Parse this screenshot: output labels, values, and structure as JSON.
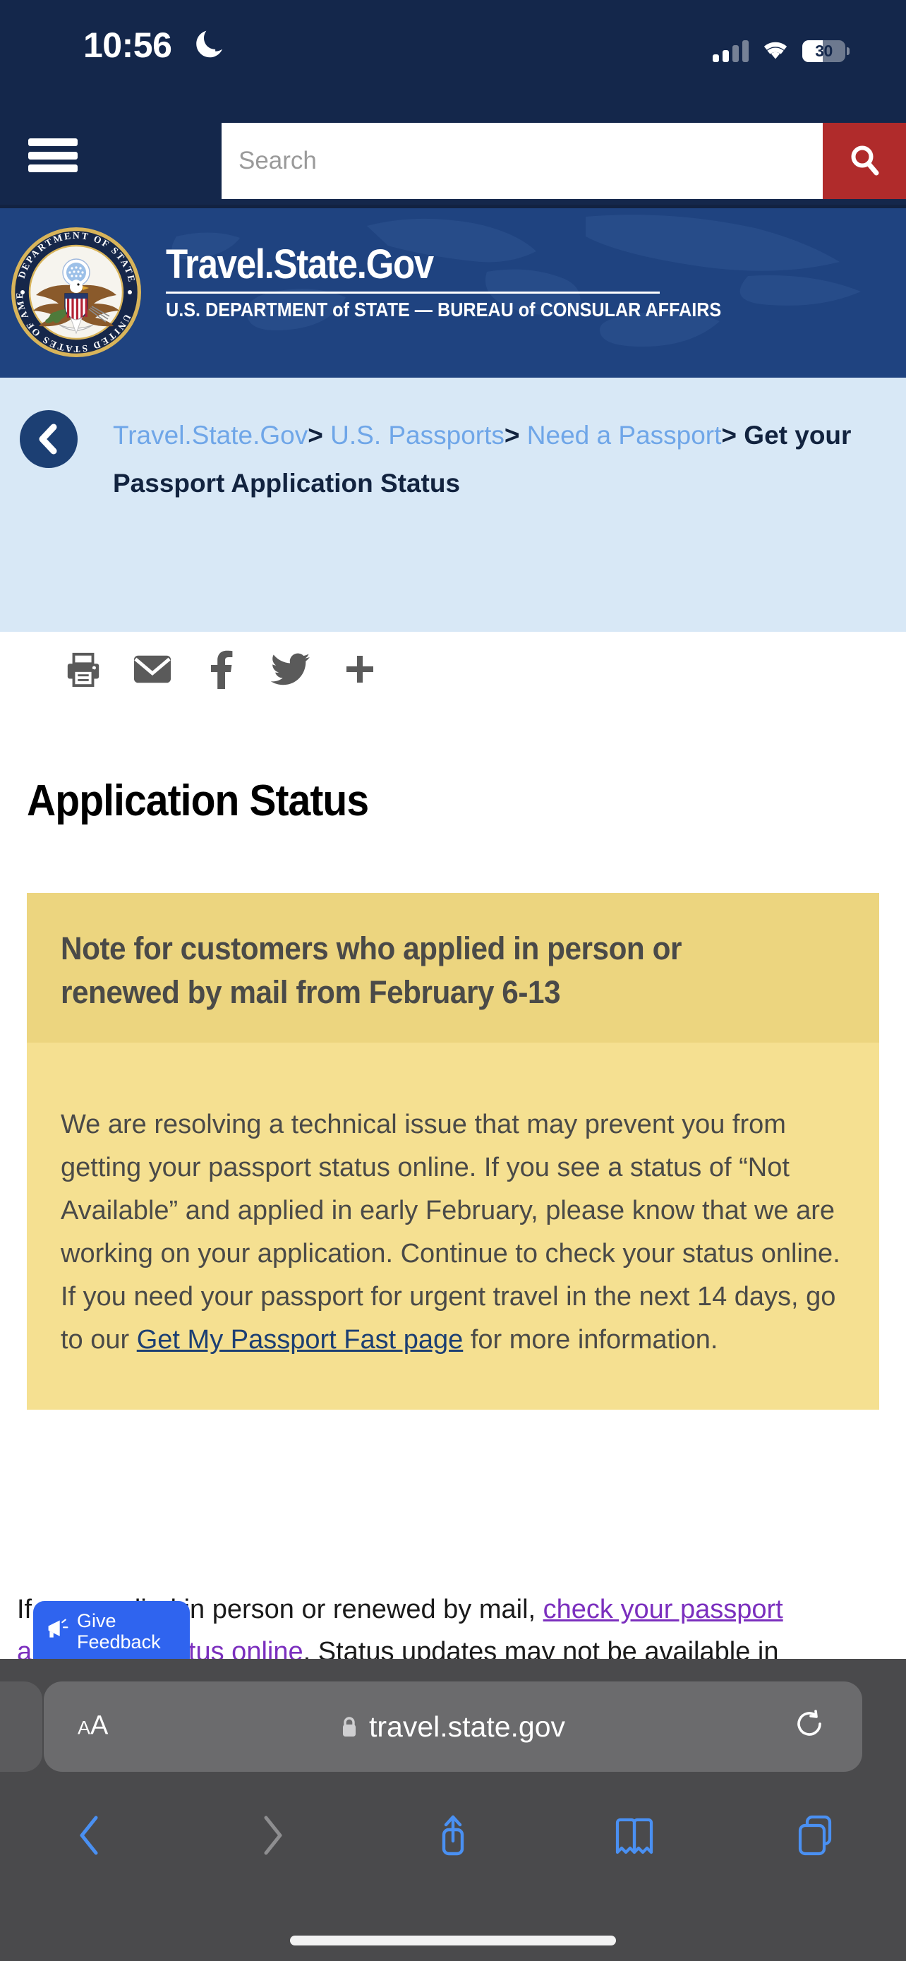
{
  "status_bar": {
    "time": "10:56",
    "moon_icon": "crescent-moon-icon",
    "signal_icon": "cellular-signal-icon",
    "wifi_icon": "wifi-icon",
    "battery_percent": "30"
  },
  "utility_nav": {
    "menu_icon": "hamburger-menu-icon",
    "search_placeholder": "Search",
    "search_value": "",
    "search_icon": "magnifier-icon",
    "search_button_color": "#b02b2b"
  },
  "banner": {
    "seal_icon": "department-of-state-seal-icon",
    "title": "Travel.State.Gov",
    "subtitle": "U.S. DEPARTMENT of STATE — BUREAU of CONSULAR AFFAIRS",
    "background_color": "#1f4380"
  },
  "breadcrumb": {
    "back_icon": "back-chevron-icon",
    "items": [
      {
        "label": "Travel.State.Gov",
        "current": false
      },
      {
        "label": "U.S. Passports",
        "current": false
      },
      {
        "label": "Need a Passport",
        "current": false
      },
      {
        "label": "Get your Passport Application Status",
        "current": true
      }
    ],
    "separator": ">",
    "link_color": "#6fa6e8",
    "background_color": "#d8e8f6"
  },
  "share_row": {
    "icons": [
      {
        "name": "print-icon",
        "label": "Print"
      },
      {
        "name": "email-icon",
        "label": "Email"
      },
      {
        "name": "facebook-icon",
        "label": "Facebook"
      },
      {
        "name": "twitter-icon",
        "label": "Twitter"
      },
      {
        "name": "share-more-icon",
        "label": "More"
      }
    ]
  },
  "main": {
    "page_title": "Application Status",
    "alert": {
      "heading": "Note for customers who applied in person or renewed by mail from February 6-13",
      "body_before_link": "We are resolving a technical issue that may prevent you from getting your passport status online. If you see a status of “Not Available” and applied in early February, please know that we are working on your application. Continue to check your status online. If you need your passport for urgent travel in the next 14 days, go to our ",
      "body_link": "Get My Passport Fast page",
      "body_after_link": " for more information.",
      "header_bg": "#ecd57f",
      "body_bg": "#f5e091"
    },
    "tail_paragraph": {
      "before_link": "If you applied in person or renewed by mail, ",
      "link": "check your passport application status online",
      "after_link": ". Status updates may not be available in"
    }
  },
  "feedback": {
    "label": "Give Feedback",
    "icon": "megaphone-icon",
    "color": "#2f64ef"
  },
  "safari": {
    "text_size_label": "A",
    "text_size_label_small": "A",
    "lock_icon": "padlock-icon",
    "url": "travel.state.gov",
    "reload_icon": "reload-icon",
    "toolbar": [
      {
        "name": "back-icon",
        "enabled": true
      },
      {
        "name": "forward-icon",
        "enabled": false
      },
      {
        "name": "share-icon",
        "enabled": true
      },
      {
        "name": "bookmarks-icon",
        "enabled": true
      },
      {
        "name": "tabs-icon",
        "enabled": true
      }
    ]
  }
}
